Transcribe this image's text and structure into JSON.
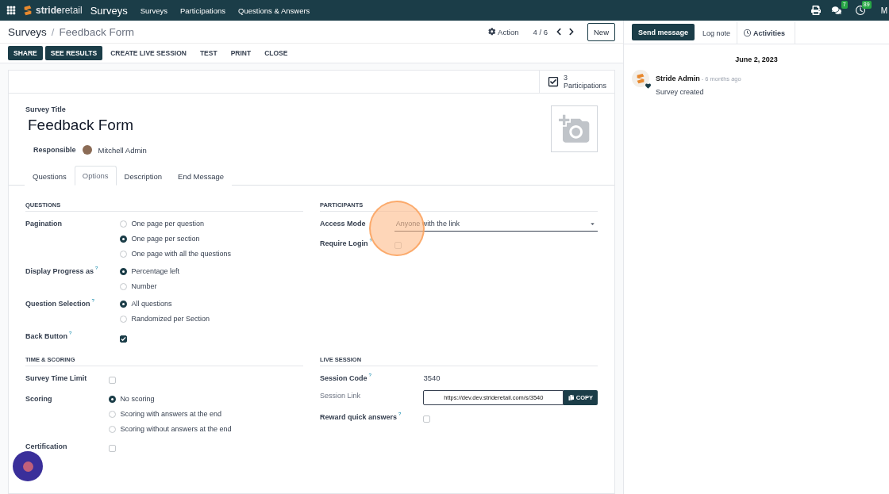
{
  "navbar": {
    "logo": "**stride**retail",
    "app_name": "Surveys",
    "menu": [
      "Surveys",
      "Participations",
      "Questions & Answers"
    ],
    "messages_badge": "7",
    "activities_badge": "89",
    "user": "M"
  },
  "control_panel": {
    "breadcrumb": [
      "Surveys",
      "Feedback Form"
    ],
    "breadcrumb_separator": "/",
    "action": "Action",
    "pager": "4 / 6",
    "new_button": "New",
    "buttons": [
      {
        "label": "SHARE",
        "kind": "primary"
      },
      {
        "label": "SEE RESULTS",
        "kind": "primary"
      },
      {
        "label": "CREATE LIVE SESSION",
        "kind": "plain"
      },
      {
        "label": "TEST",
        "kind": "plain"
      },
      {
        "label": "PRINT",
        "kind": "plain"
      },
      {
        "label": "CLOSE",
        "kind": "plain"
      }
    ]
  },
  "stat_button": {
    "count": "3",
    "label": "Participations"
  },
  "form": {
    "title_label": "Survey Title",
    "title": "Feedback Form",
    "responsible_label": "Responsible",
    "responsible": "Mitchell Admin",
    "tabs": [
      {
        "label": "Questions",
        "selected": false
      },
      {
        "label": "Options",
        "selected": true
      },
      {
        "label": "Description",
        "selected": false
      },
      {
        "label": "End Message",
        "selected": false
      }
    ],
    "sections": [
      {
        "title": "QUESTIONS",
        "fields": [
          {
            "label": "Pagination",
            "kind": "radio",
            "options": [
              {
                "label": "One page per question",
                "selected": false
              },
              {
                "label": "One page per section",
                "selected": true
              },
              {
                "label": "One page with all the questions",
                "selected": false
              }
            ]
          },
          {
            "label": "Display Progress as",
            "help": "?",
            "kind": "radio",
            "options": [
              {
                "label": "Percentage left",
                "selected": true
              },
              {
                "label": "Number",
                "selected": false
              }
            ]
          },
          {
            "label": "Question Selection",
            "help": "?",
            "kind": "radio",
            "options": [
              {
                "label": "All questions",
                "selected": true
              },
              {
                "label": "Randomized per Section",
                "selected": false
              }
            ]
          },
          {
            "label": "Back Button",
            "help": "?",
            "kind": "checkbox",
            "checked": true
          }
        ]
      },
      {
        "title": "PARTICIPANTS",
        "fields": [
          {
            "label": "Access Mode",
            "kind": "select",
            "value": "Anyone with the link"
          },
          {
            "label": "Require Login",
            "help": "?",
            "kind": "checkbox",
            "checked": false
          }
        ]
      },
      {
        "title": "TIME & SCORING",
        "fields": [
          {
            "label": "Survey Time Limit",
            "kind": "checkbox",
            "checked": false
          },
          {
            "label": "Scoring",
            "kind": "radio",
            "options": [
              {
                "label": "No scoring",
                "selected": true
              },
              {
                "label": "Scoring with answers at the end",
                "selected": false
              },
              {
                "label": "Scoring without answers at the end",
                "selected": false
              }
            ]
          },
          {
            "label": "Certification",
            "kind": "checkbox",
            "checked": false
          }
        ]
      },
      {
        "title": "LIVE SESSION",
        "fields": [
          {
            "label": "Session Code",
            "help": "?",
            "kind": "text",
            "value": "3540"
          },
          {
            "label": "Session Link",
            "kind": "link",
            "value": "https://dev.dev.strideretail.com/s/3540",
            "button": "COPY"
          },
          {
            "label": "Reward quick answers",
            "help": "?",
            "kind": "checkbox",
            "checked": false
          }
        ]
      }
    ]
  },
  "chatter": {
    "buttons": [
      {
        "label": "Send message",
        "kind": "primary"
      },
      {
        "label": "Log note",
        "kind": "plain"
      },
      {
        "label": "Activities",
        "kind": "activities"
      }
    ],
    "date": "June 2, 2023",
    "message": {
      "author": "Stride Admin",
      "time": "- 6 months ago",
      "body": "Survey created"
    }
  }
}
